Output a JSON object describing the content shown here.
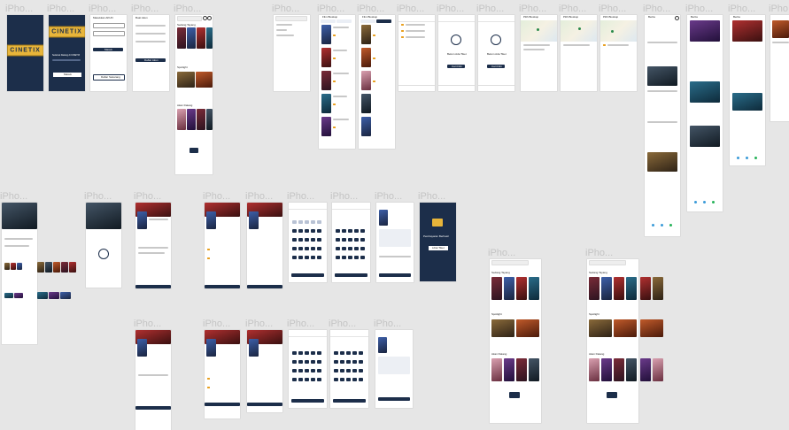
{
  "frame_label": "iPho...",
  "brand": {
    "logo_text": "CINETIX",
    "navy": "#1c2e4a",
    "gold": "#e8b53a",
    "accent": "#e8a020"
  },
  "splash": {
    "tagline": "Selamat Datang di CINETIX",
    "button": "Masuk"
  },
  "login": {
    "title": "Masukkan AKUN",
    "button": "Masuk",
    "alt_button": "Daftar Sekarang"
  },
  "register": {
    "title": "Buat Akun",
    "button": "Daftar Akun"
  },
  "home": {
    "sections": [
      "Sedang Tayang",
      "Spotlight",
      "Akan Datang"
    ]
  },
  "film_list": {
    "title": "Film Bioskop",
    "tabs": [
      "Sedang Tayang",
      "Akan Datang"
    ]
  },
  "empty_tickets": {
    "message": "Belum Ada Tiket",
    "button": "Cari Film"
  },
  "cinemas": {
    "title": "Pilih Bioskop"
  },
  "news": {
    "title": "Berita"
  },
  "payment_success": {
    "message": "Pembayaran Berhasil",
    "button": "Lihat Tiket"
  },
  "seat": {
    "button": "Pilih Kursi"
  },
  "icons": [
    "back-icon",
    "search-icon",
    "bell-icon",
    "home-icon",
    "ticket-icon",
    "user-icon",
    "share-icon",
    "location-pin-icon"
  ]
}
